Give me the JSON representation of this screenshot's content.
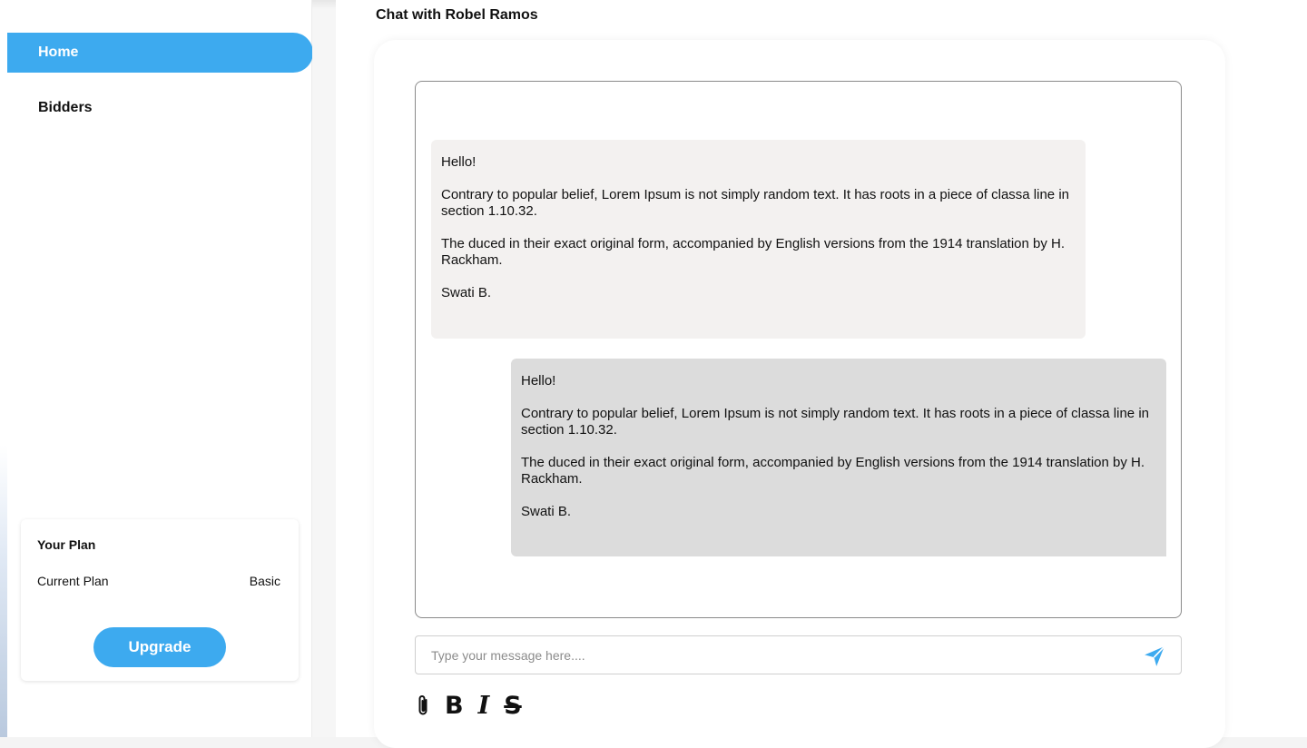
{
  "sidebar": {
    "items": [
      {
        "label": "Home",
        "active": true
      },
      {
        "label": "Bidders",
        "active": false
      }
    ]
  },
  "plan": {
    "title": "Your Plan",
    "current_label": "Current Plan",
    "current_value": "Basic",
    "upgrade_label": "Upgrade"
  },
  "chat": {
    "title": "Chat with Robel Ramos",
    "messages": [
      {
        "direction": "incoming",
        "paragraphs": [
          "Hello!",
          "Contrary to popular belief, Lorem Ipsum is not simply random text. It has roots in a piece of classa line in section 1.10.32.",
          "The duced in their exact original form, accompanied by English versions from the 1914 translation by H. Rackham.",
          "Swati B."
        ]
      },
      {
        "direction": "outgoing",
        "paragraphs": [
          "Hello!",
          "Contrary to popular belief, Lorem Ipsum is not simply random text. It has roots in a piece of classa line in section 1.10.32.",
          "The duced in their exact original form, accompanied by English versions from the 1914 translation by H. Rackham.",
          "Swati B."
        ]
      }
    ]
  },
  "composer": {
    "placeholder": "Type your message here....",
    "value": ""
  },
  "toolbar": {
    "bold_label": "B",
    "italic_label": "I",
    "strike_label": "S",
    "attach_icon": "paperclip-icon",
    "send_icon": "send-icon"
  },
  "colors": {
    "accent": "#3daaef",
    "incoming_bubble": "#f3f1f0",
    "outgoing_bubble": "#dcdcdc"
  }
}
